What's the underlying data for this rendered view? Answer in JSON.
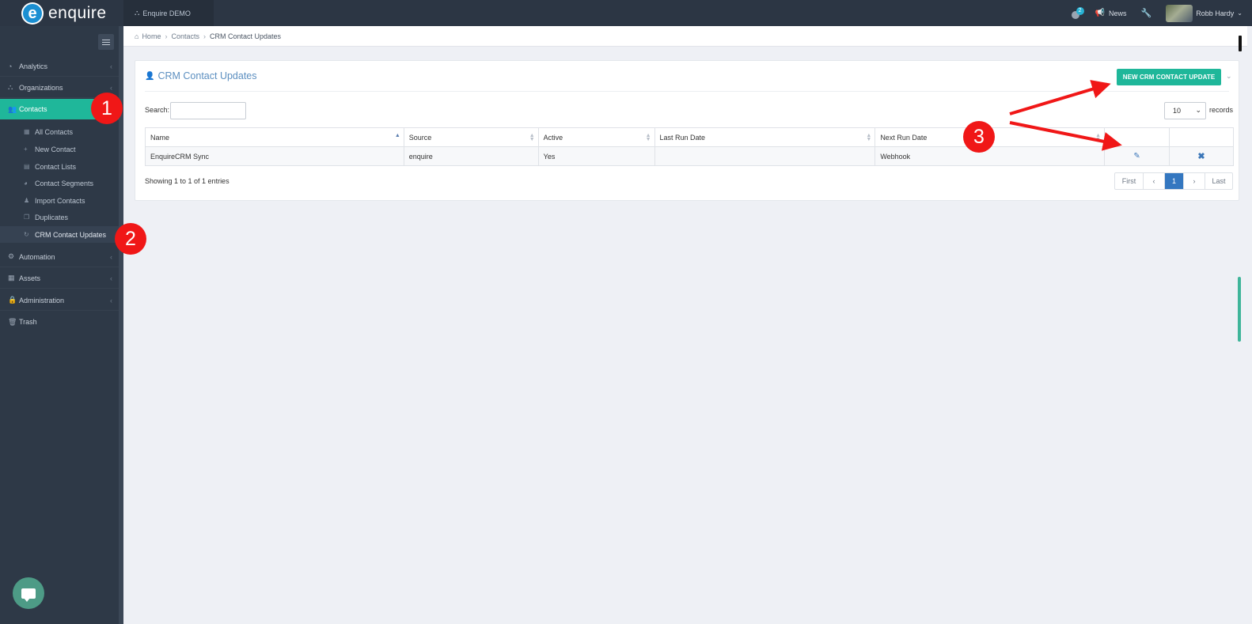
{
  "topbar": {
    "brand": "enquire",
    "brand_initial": "e",
    "tenant": "Enquire DEMO",
    "notification_count": "2",
    "news_label": "News",
    "user_name": "Robb Hardy",
    "icons": [
      "sitemap-icon",
      "info-icon",
      "bullhorn-icon",
      "wrench-icon",
      "chevron-down-icon"
    ]
  },
  "sidebar": {
    "items": [
      {
        "label": "Analytics"
      },
      {
        "label": "Organizations"
      },
      {
        "label": "Contacts"
      },
      {
        "label": "Automation"
      },
      {
        "label": "Assets"
      },
      {
        "label": "Administration"
      },
      {
        "label": "Trash"
      }
    ],
    "contacts_sub": [
      {
        "label": "All Contacts"
      },
      {
        "label": "New Contact"
      },
      {
        "label": "Contact Lists"
      },
      {
        "label": "Contact Segments"
      },
      {
        "label": "Import Contacts"
      },
      {
        "label": "Duplicates"
      },
      {
        "label": "CRM Contact Updates"
      }
    ]
  },
  "breadcrumb": {
    "home": "Home",
    "contacts": "Contacts",
    "current": "CRM Contact Updates"
  },
  "panel": {
    "title": "CRM Contact Updates",
    "new_button": "NEW CRM CONTACT UPDATE",
    "search_label": "Search:",
    "search_value": "",
    "page_length": "10",
    "records_label": "records",
    "columns": [
      "Name",
      "Source",
      "Active",
      "Last Run Date",
      "Next Run Date"
    ],
    "rows": [
      {
        "name": "EnquireCRM Sync",
        "source": "enquire",
        "active": "Yes",
        "last_run": "",
        "next_run": "Webhook"
      }
    ],
    "info": "Showing 1 to 1 of 1 entries",
    "pager": {
      "first": "First",
      "prev": "‹",
      "page": "1",
      "next": "›",
      "last": "Last"
    }
  },
  "annotations": {
    "one": "1",
    "two": "2",
    "three": "3"
  },
  "colors": {
    "accent": "#1fb79a",
    "topbar": "#2c3644",
    "sidebar": "#2e3947",
    "link": "#3477c0",
    "annotation": "#f01717"
  }
}
